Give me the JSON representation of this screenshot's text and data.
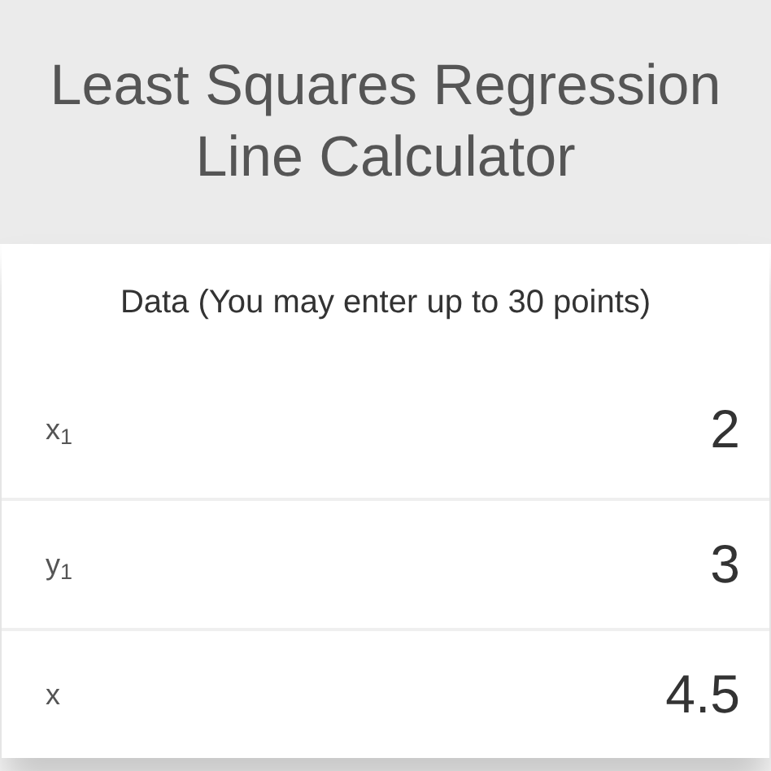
{
  "header": {
    "title": "Least Squares Regression Line Calculator"
  },
  "section": {
    "label": "Data (You may enter up to 30 points)"
  },
  "rows": [
    {
      "label": "x$_{1}$",
      "value": "2"
    },
    {
      "label": "y$_{1}$",
      "value": "3"
    },
    {
      "label": "x",
      "value": "4.5"
    }
  ]
}
